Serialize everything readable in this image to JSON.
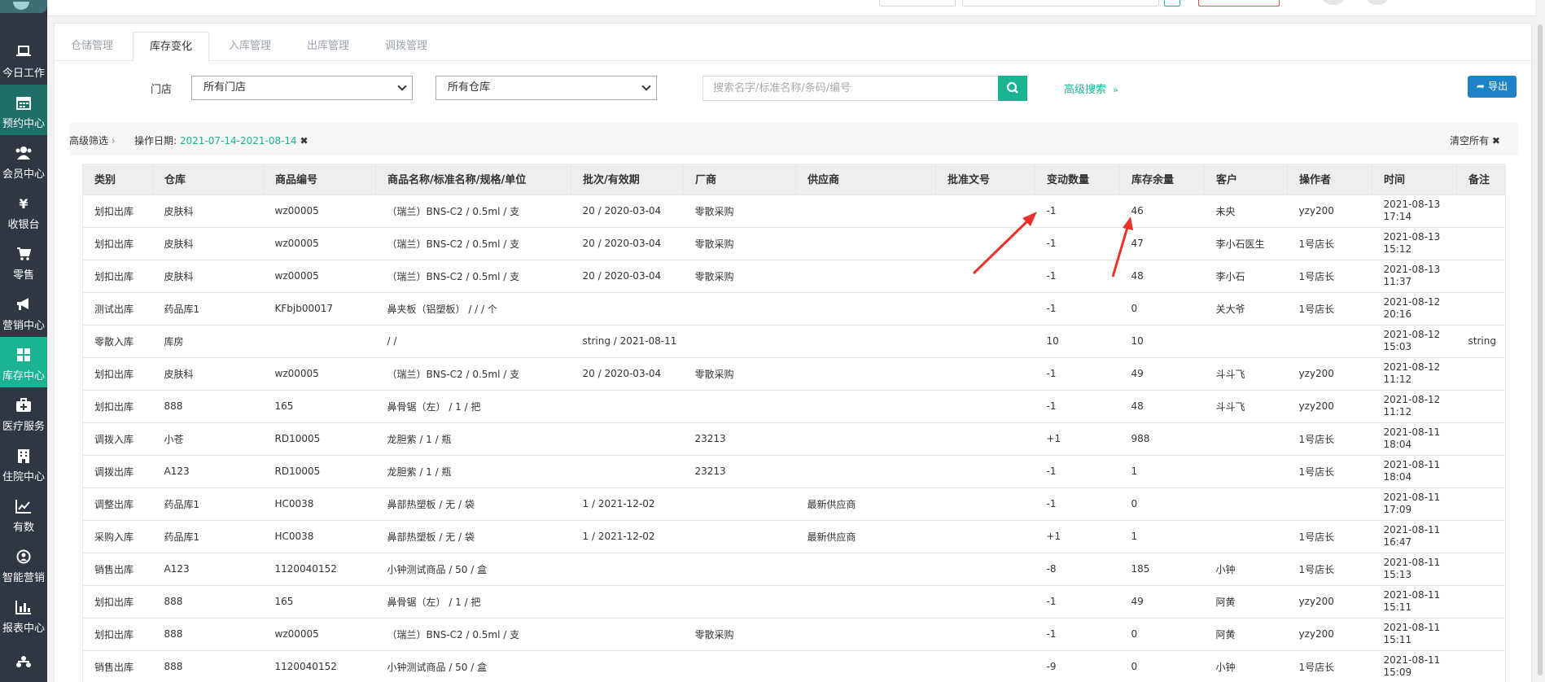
{
  "sidebar": {
    "items": [
      {
        "label": "今日工作",
        "icon": "laptop-icon"
      },
      {
        "label": "预约中心",
        "icon": "calendar-icon"
      },
      {
        "label": "会员中心",
        "icon": "users-icon"
      },
      {
        "label": "收银台",
        "icon": "yen-icon"
      },
      {
        "label": "零售",
        "icon": "cart-icon"
      },
      {
        "label": "营销中心",
        "icon": "bullhorn-icon"
      },
      {
        "label": "库存中心",
        "icon": "grid-icon"
      },
      {
        "label": "医疗服务",
        "icon": "medkit-icon"
      },
      {
        "label": "住院中心",
        "icon": "building-icon"
      },
      {
        "label": "有数",
        "icon": "line-chart-icon"
      },
      {
        "label": "智能营销",
        "icon": "person-circle-icon"
      },
      {
        "label": "报表中心",
        "icon": "bar-chart-icon"
      }
    ]
  },
  "tabs": [
    "仓储管理",
    "库存变化",
    "入库管理",
    "出库管理",
    "调拨管理"
  ],
  "filters": {
    "store_label": "门店",
    "store_value": "所有门店",
    "warehouse_value": "所有仓库",
    "search_placeholder": "搜索名字/标准名称/条码/编号",
    "advanced_search": "高级搜索",
    "export": "导出"
  },
  "filterbar": {
    "title": "高级筛选",
    "date_label": "操作日期:",
    "date_value": "2021-07-14-2021-08-14",
    "clear_all": "清空所有"
  },
  "table": {
    "headers": [
      "类别",
      "仓库",
      "商品编号",
      "商品名称/标准名称/规格/单位",
      "批次/有效期",
      "厂商",
      "供应商",
      "批准文号",
      "变动数量",
      "库存余量",
      "客户",
      "操作者",
      "时间",
      "备注"
    ],
    "rows": [
      [
        "划扣出库",
        "皮肤科",
        "wz00005",
        "（瑞兰）BNS-C2 / 0.5ml / 支",
        "20 / 2020-03-04",
        "零散采购",
        "",
        "",
        "-1",
        "46",
        "未央",
        "yzy200",
        "2021-08-13 17:14",
        ""
      ],
      [
        "划扣出库",
        "皮肤科",
        "wz00005",
        "（瑞兰）BNS-C2 / 0.5ml / 支",
        "20 / 2020-03-04",
        "零散采购",
        "",
        "",
        "-1",
        "47",
        "李小石医生",
        "1号店长",
        "2021-08-13 15:12",
        ""
      ],
      [
        "划扣出库",
        "皮肤科",
        "wz00005",
        "（瑞兰）BNS-C2 / 0.5ml / 支",
        "20 / 2020-03-04",
        "零散采购",
        "",
        "",
        "-1",
        "48",
        "李小石",
        "1号店长",
        "2021-08-13 11:37",
        ""
      ],
      [
        "测试出库",
        "药品库1",
        "KFbjb00017",
        "鼻夹板（铝塑板） / / / 个",
        "",
        "",
        "",
        "",
        "-1",
        "0",
        "关大爷",
        "1号店长",
        "2021-08-12 20:16",
        ""
      ],
      [
        "零散入库",
        "库房",
        "",
        "/ /",
        "string / 2021-08-11",
        "",
        "",
        "",
        "10",
        "10",
        "",
        "",
        "2021-08-12 15:03",
        "string"
      ],
      [
        "划扣出库",
        "皮肤科",
        "wz00005",
        "（瑞兰）BNS-C2 / 0.5ml / 支",
        "20 / 2020-03-04",
        "零散采购",
        "",
        "",
        "-1",
        "49",
        "斗斗飞",
        "yzy200",
        "2021-08-12 11:12",
        ""
      ],
      [
        "划扣出库",
        "888",
        "165",
        "鼻骨锯（左） / 1 / 把",
        "",
        "",
        "",
        "",
        "-1",
        "48",
        "斗斗飞",
        "yzy200",
        "2021-08-12 11:12",
        ""
      ],
      [
        "调拨入库",
        "小苍",
        "RD10005",
        "龙胆紫 / 1 / 瓶",
        "",
        "23213",
        "",
        "",
        "+1",
        "988",
        "",
        "1号店长",
        "2021-08-11 18:04",
        ""
      ],
      [
        "调拨出库",
        "A123",
        "RD10005",
        "龙胆紫 / 1 / 瓶",
        "",
        "23213",
        "",
        "",
        "-1",
        "1",
        "",
        "1号店长",
        "2021-08-11 18:04",
        ""
      ],
      [
        "调整出库",
        "药品库1",
        "HC0038",
        "鼻部热塑板 / 无 / 袋",
        "1 / 2021-12-02",
        "",
        "最新供应商",
        "",
        "-1",
        "0",
        "",
        "",
        "2021-08-11 17:09",
        ""
      ],
      [
        "采购入库",
        "药品库1",
        "HC0038",
        "鼻部热塑板 / 无 / 袋",
        "1 / 2021-12-02",
        "",
        "最新供应商",
        "",
        "+1",
        "1",
        "",
        "1号店长",
        "2021-08-11 16:47",
        ""
      ],
      [
        "销售出库",
        "A123",
        "1120040152",
        "小钟测试商品 / 50 / 盒",
        "",
        "",
        "",
        "",
        "-8",
        "185",
        "小钟",
        "1号店长",
        "2021-08-11 15:13",
        ""
      ],
      [
        "划扣出库",
        "888",
        "165",
        "鼻骨锯（左） / 1 / 把",
        "",
        "",
        "",
        "",
        "-1",
        "49",
        "阿黄",
        "yzy200",
        "2021-08-11 15:11",
        ""
      ],
      [
        "划扣出库",
        "888",
        "wz00005",
        "（瑞兰）BNS-C2 / 0.5ml / 支",
        "",
        "零散采购",
        "",
        "",
        "-1",
        "0",
        "阿黄",
        "yzy200",
        "2021-08-11 15:11",
        ""
      ],
      [
        "销售出库",
        "888",
        "1120040152",
        "小钟测试商品 / 50 / 盒",
        "",
        "",
        "",
        "",
        "-9",
        "0",
        "小钟",
        "1号店长",
        "2021-08-11 15:09",
        ""
      ]
    ]
  },
  "colors": {
    "accent": "#1ab394",
    "sidebar": "#2f3742",
    "export": "#1c84c6",
    "annotation_arrow": "#e8322c"
  }
}
